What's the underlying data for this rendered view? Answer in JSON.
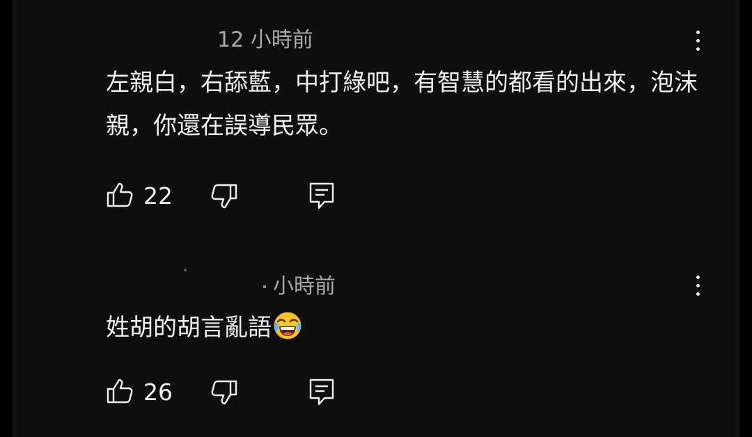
{
  "colors": {
    "background": "#0f0f0f",
    "text": "#f1f1f1",
    "meta_text": "#aaaaaa"
  },
  "comments": [
    {
      "timestamp": "12 小時前",
      "text": "左親白，右舔藍，中打綠吧，有智慧的都看的出來，泡沫親，你還在誤導民眾。",
      "likes": "22",
      "icons": [
        "thumbs-up-icon",
        "thumbs-down-icon",
        "reply-icon",
        "more-vertical-icon"
      ]
    },
    {
      "timestamp": "小時前",
      "text": "姓胡的胡言亂語",
      "emoji": "face-with-tears-of-joy-emoji",
      "likes": "26",
      "icons": [
        "thumbs-up-icon",
        "thumbs-down-icon",
        "reply-icon",
        "more-vertical-icon"
      ]
    }
  ]
}
